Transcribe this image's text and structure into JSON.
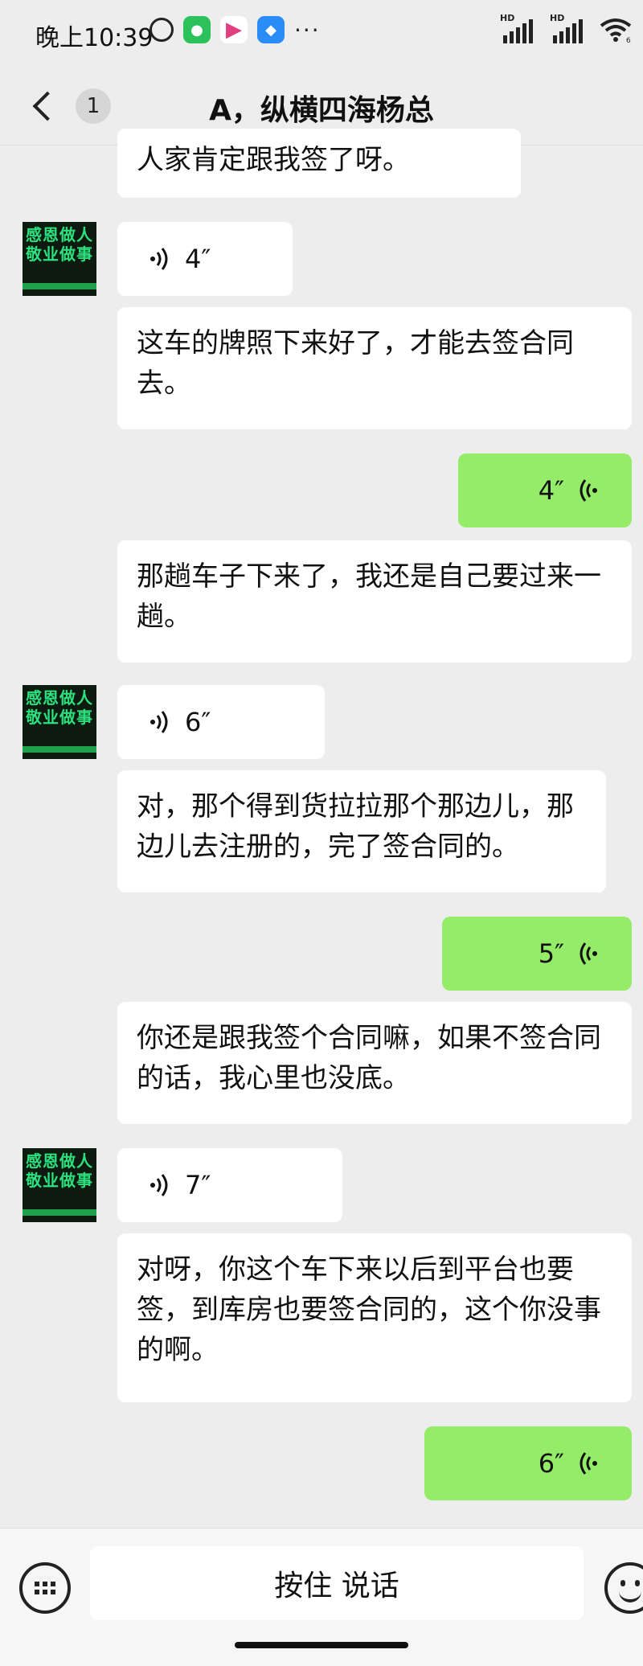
{
  "status_bar": {
    "time": "晚上10:39",
    "icons": [
      "alarm-icon",
      "wechat-icon",
      "video-app-icon",
      "notes-app-icon",
      "more-dots-icon"
    ],
    "more": "···",
    "hd1": "HD",
    "hd2": "HD",
    "wifi_level": "6"
  },
  "header": {
    "unread_count": "1",
    "title": "A，纵横四海杨总"
  },
  "avatar": {
    "line1": "感恩做人",
    "line2": "敬业做事"
  },
  "messages": [
    {
      "side": "left",
      "kind": "text",
      "text": "人家肯定跟我签了呀。"
    },
    {
      "side": "left",
      "kind": "voice",
      "duration": "4″"
    },
    {
      "side": "left",
      "kind": "text",
      "text": "这车的牌照下来好了，才能去签合同去。"
    },
    {
      "side": "right",
      "kind": "voice",
      "duration": "4″"
    },
    {
      "side": "left",
      "kind": "text",
      "text": "那趟车子下来了，我还是自己要过来一趟。"
    },
    {
      "side": "left",
      "kind": "voice",
      "duration": "6″"
    },
    {
      "side": "left",
      "kind": "text",
      "text": "对，那个得到货拉拉那个那边儿，那边儿去注册的，完了签合同的。"
    },
    {
      "side": "right",
      "kind": "voice",
      "duration": "5″"
    },
    {
      "side": "left",
      "kind": "text",
      "text": "你还是跟我签个合同嘛，如果不签合同的话，我心里也没底。"
    },
    {
      "side": "left",
      "kind": "voice",
      "duration": "7″"
    },
    {
      "side": "left",
      "kind": "text",
      "text": "对呀，你这个车下来以后到平台也要签，到库房也要签合同的，这个你没事的啊。"
    },
    {
      "side": "right",
      "kind": "voice",
      "duration": "6″"
    }
  ],
  "input_bar": {
    "hold_to_talk": "按住 说话"
  },
  "colors": {
    "background": "#ededed",
    "bubble_self": "#95ec69",
    "bubble_other": "#ffffff"
  }
}
